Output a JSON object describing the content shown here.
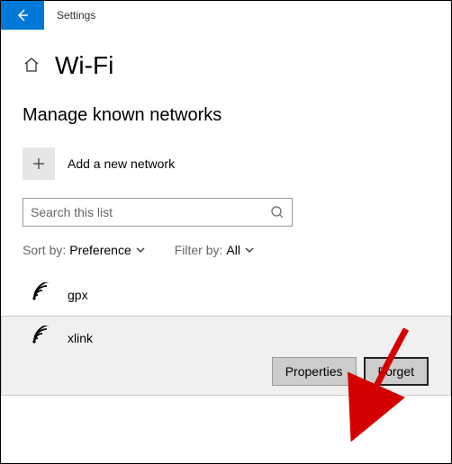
{
  "titlebar": {
    "label": "Settings"
  },
  "page": {
    "title": "Wi-Fi"
  },
  "section": {
    "title": "Manage known networks"
  },
  "addNetwork": {
    "label": "Add a new network"
  },
  "search": {
    "placeholder": "Search this list"
  },
  "sort": {
    "label": "Sort by:",
    "value": "Preference"
  },
  "filter": {
    "label": "Filter by:",
    "value": "All"
  },
  "networks": [
    {
      "name": "gpx",
      "selected": false
    },
    {
      "name": "xlink",
      "selected": true
    }
  ],
  "buttons": {
    "properties": "Properties",
    "forget": "Forget"
  }
}
